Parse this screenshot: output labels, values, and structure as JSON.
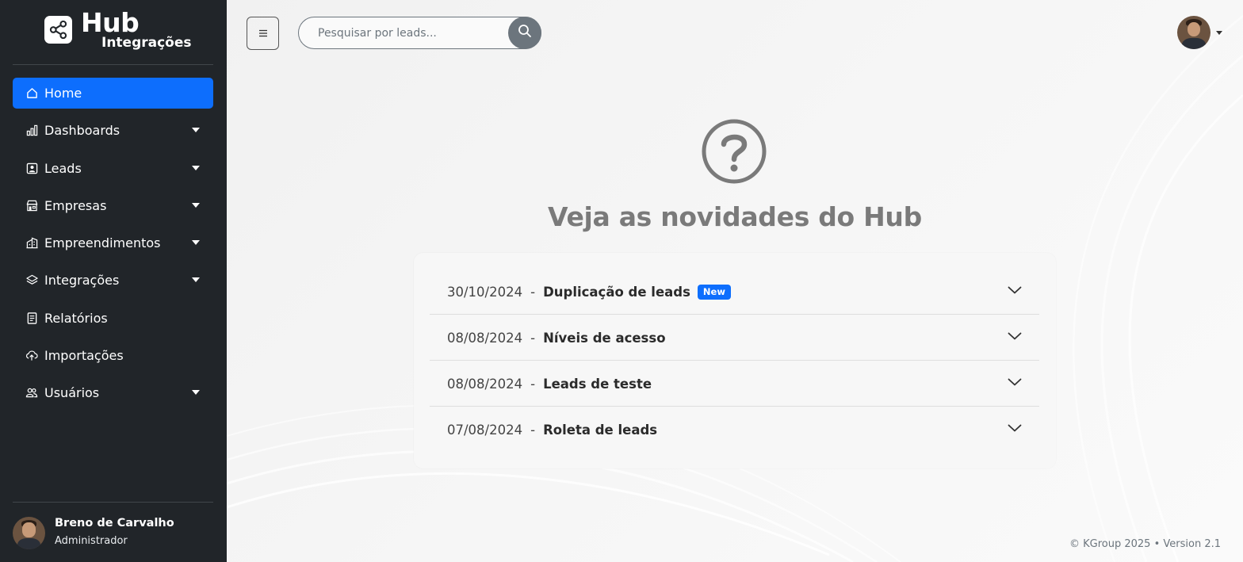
{
  "brand": {
    "title": "Hub",
    "subtitle": "Integrações",
    "logo_icon": "share-nodes-icon"
  },
  "colors": {
    "sidebar_bg": "#212529",
    "accent": "#0d6efd",
    "muted": "#6c757d"
  },
  "sidebar": {
    "items": [
      {
        "label": "Home",
        "icon": "home-icon",
        "active": true,
        "has_submenu": false
      },
      {
        "label": "Dashboards",
        "icon": "bar-chart-icon",
        "active": false,
        "has_submenu": true
      },
      {
        "label": "Leads",
        "icon": "person-badge-icon",
        "active": false,
        "has_submenu": true
      },
      {
        "label": "Empresas",
        "icon": "shop-icon",
        "active": false,
        "has_submenu": true
      },
      {
        "label": "Empreendimentos",
        "icon": "buildings-icon",
        "active": false,
        "has_submenu": true
      },
      {
        "label": "Integrações",
        "icon": "layers-icon",
        "active": false,
        "has_submenu": true
      },
      {
        "label": "Relatórios",
        "icon": "document-icon",
        "active": false,
        "has_submenu": false
      },
      {
        "label": "Importações",
        "icon": "cloud-upload-icon",
        "active": false,
        "has_submenu": false
      },
      {
        "label": "Usuários",
        "icon": "people-icon",
        "active": false,
        "has_submenu": true
      }
    ]
  },
  "user": {
    "name": "Breno de Carvalho",
    "role": "Administrador"
  },
  "header": {
    "menu_icon": "hamburger-menu-icon",
    "search_placeholder": "Pesquisar por leads...",
    "search_icon": "search-icon"
  },
  "main": {
    "icon": "question-circle-icon",
    "title": "Veja as novidades do Hub",
    "news": [
      {
        "date": "30/10/2024",
        "separator": "-",
        "title": "Duplicação de leads",
        "badge": "New"
      },
      {
        "date": "08/08/2024",
        "separator": "-",
        "title": "Níveis de acesso",
        "badge": ""
      },
      {
        "date": "08/08/2024",
        "separator": "-",
        "title": "Leads de teste",
        "badge": ""
      },
      {
        "date": "07/08/2024",
        "separator": "-",
        "title": "Roleta de leads",
        "badge": ""
      }
    ]
  },
  "footer": {
    "text": "© KGroup 2025 • Version 2.1"
  }
}
